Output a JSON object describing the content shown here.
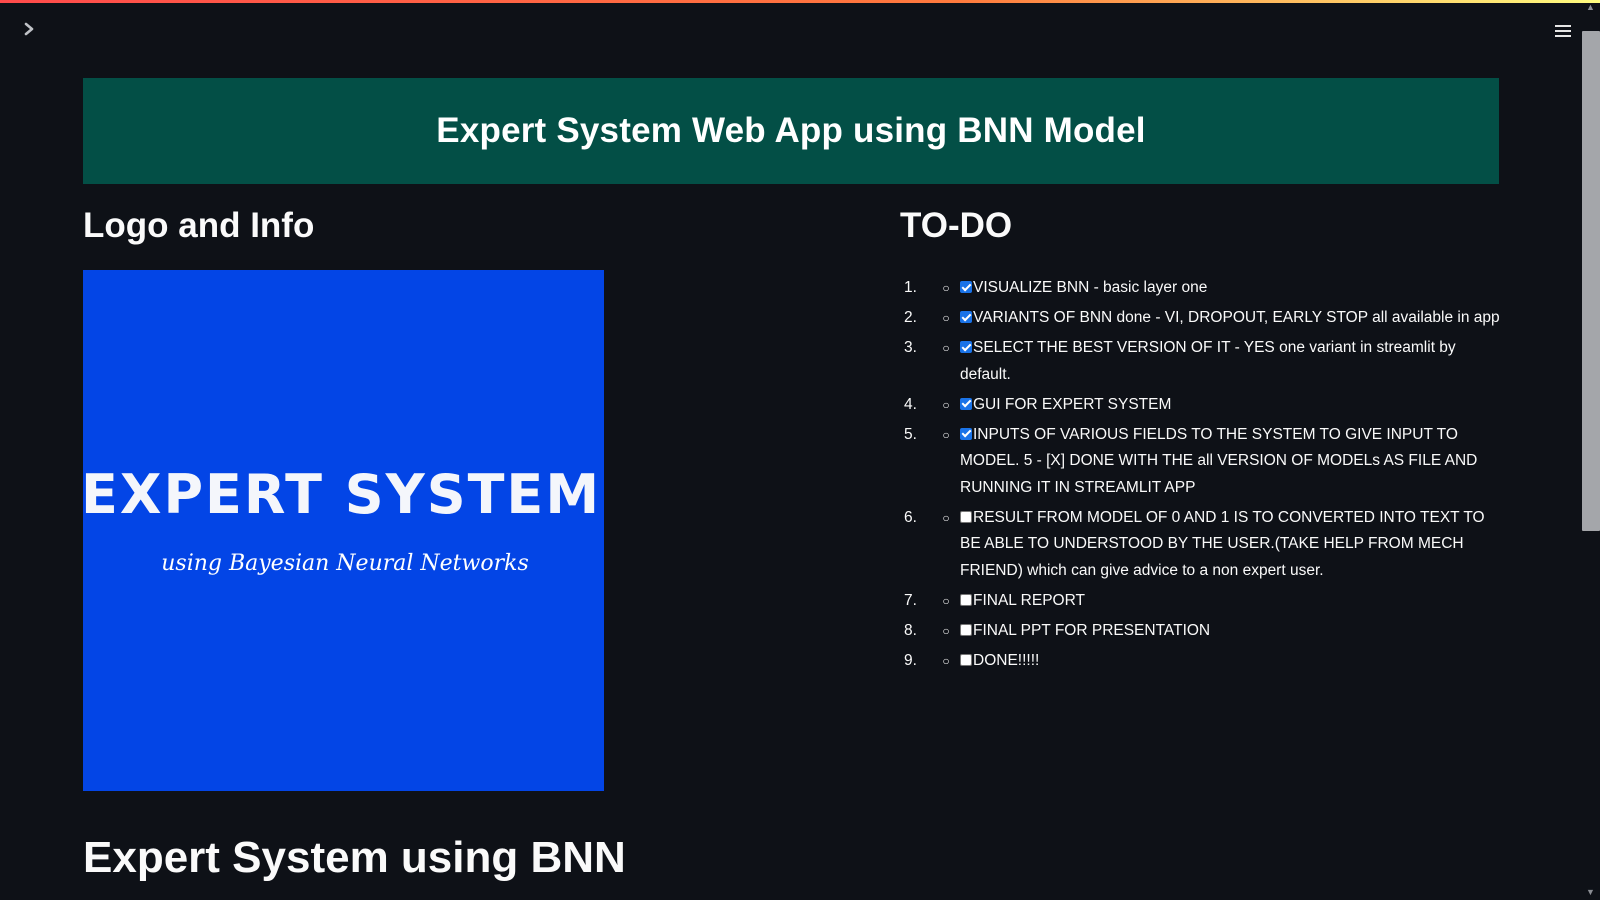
{
  "header": {
    "sidebar_icon": "chevron-right-icon",
    "menu_icon": "hamburger-menu-icon"
  },
  "banner": {
    "title": "Expert System Web App using BNN Model",
    "bg_color": "#034f46"
  },
  "logo_section": {
    "heading": "Logo and Info",
    "logo_title": "EXPERT SYSTEM",
    "logo_subtitle": "using Bayesian Neural Networks",
    "logo_bg": "#0345e6"
  },
  "todo": {
    "heading": "TO-DO",
    "items": [
      {
        "num": "1.",
        "checked": true,
        "text": "VISUALIZE BNN - basic layer one"
      },
      {
        "num": "2.",
        "checked": true,
        "text": "VARIANTS OF BNN done - VI, DROPOUT, EARLY STOP all available in app"
      },
      {
        "num": "3.",
        "checked": true,
        "text": "SELECT THE BEST VERSION OF IT - YES one variant in streamlit by default."
      },
      {
        "num": "4.",
        "checked": true,
        "text": "GUI FOR EXPERT SYSTEM"
      },
      {
        "num": "5.",
        "checked": true,
        "text": "INPUTS OF VARIOUS FIELDS TO THE SYSTEM TO GIVE INPUT TO MODEL. 5 - [X] DONE WITH THE all VERSION OF MODELs AS FILE AND RUNNING IT IN STREAMLIT APP"
      },
      {
        "num": "6.",
        "checked": false,
        "text": "RESULT FROM MODEL OF 0 AND 1 IS TO CONVERTED INTO TEXT TO BE ABLE TO UNDERSTOOD BY THE USER.(TAKE HELP FROM MECH FRIEND) which can give advice to a non expert user."
      },
      {
        "num": "7.",
        "checked": false,
        "text": "FINAL REPORT"
      },
      {
        "num": "8.",
        "checked": false,
        "text": "FINAL PPT FOR PRESENTATION"
      },
      {
        "num": "9.",
        "checked": false,
        "text": "DONE!!!!!"
      }
    ]
  },
  "bottom": {
    "heading": "Expert System using BNN"
  }
}
